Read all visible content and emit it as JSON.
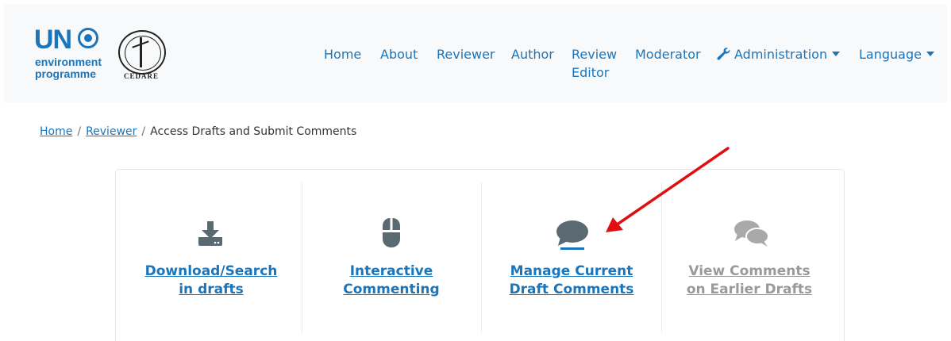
{
  "logo": {
    "un_text": "UN",
    "un_line1": "environment",
    "un_line2": "programme",
    "cedare_text": "CEDARE"
  },
  "nav": {
    "home": "Home",
    "about": "About",
    "reviewer": "Reviewer",
    "author": "Author",
    "review_editor": "Review Editor",
    "moderator": "Moderator",
    "administration": "Administration",
    "language": "Language"
  },
  "breadcrumb": {
    "home": "Home",
    "reviewer": "Reviewer",
    "current": "Access Drafts and Submit Comments",
    "separator": "/"
  },
  "tiles": [
    {
      "label": "Download/Search in drafts",
      "icon": "download-icon",
      "state": "active"
    },
    {
      "label": "Interactive Commenting",
      "icon": "mouse-icon",
      "state": "active"
    },
    {
      "label": "Manage Current Draft Comments",
      "icon": "comment-icon",
      "state": "active"
    },
    {
      "label": "View Comments on Earlier Drafts",
      "icon": "comments-icon",
      "state": "disabled"
    }
  ],
  "colors": {
    "link": "#1a75bb",
    "icon": "#5a6a72",
    "disabled": "#9a9a9a",
    "annotation_arrow": "#e01010"
  }
}
